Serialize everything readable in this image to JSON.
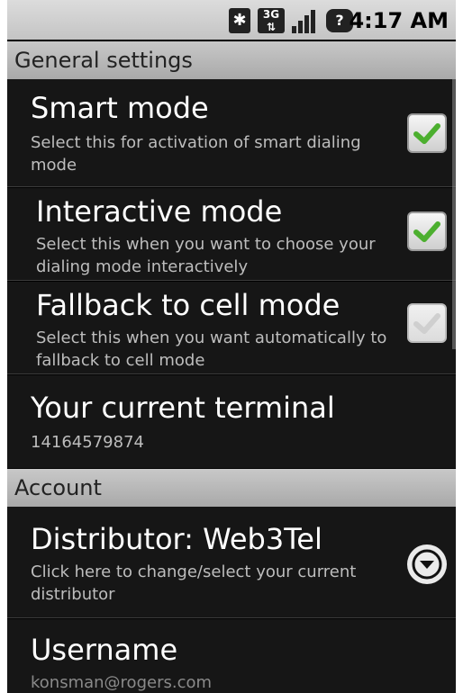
{
  "status_bar": {
    "icons": [
      "bluetooth-icon",
      "3g-icon",
      "signal-icon",
      "help-icon"
    ],
    "time": "4:17 AM"
  },
  "sections": {
    "general": {
      "header": "General settings"
    },
    "account": {
      "header": "Account"
    }
  },
  "general_items": [
    {
      "title": "Smart mode",
      "summary": "Select this for activation of smart dialing mode",
      "checked": true
    },
    {
      "title": "Interactive mode",
      "summary": "Select this when you want to choose your dialing mode interactively",
      "checked": true
    },
    {
      "title": "Fallback to cell mode",
      "summary": "Select this when you want automatically to fallback to cell mode",
      "checked": false
    },
    {
      "title": "Your current terminal",
      "summary": "14164579874"
    }
  ],
  "account_items": [
    {
      "title": "Distributor: Web3Tel",
      "summary": "Click here to change/select your current distributor"
    },
    {
      "title": "Username",
      "summary": "konsman@rogers.com"
    }
  ],
  "colors": {
    "check_green": "#4caf2f",
    "check_disabled": "#d0d0d0"
  }
}
